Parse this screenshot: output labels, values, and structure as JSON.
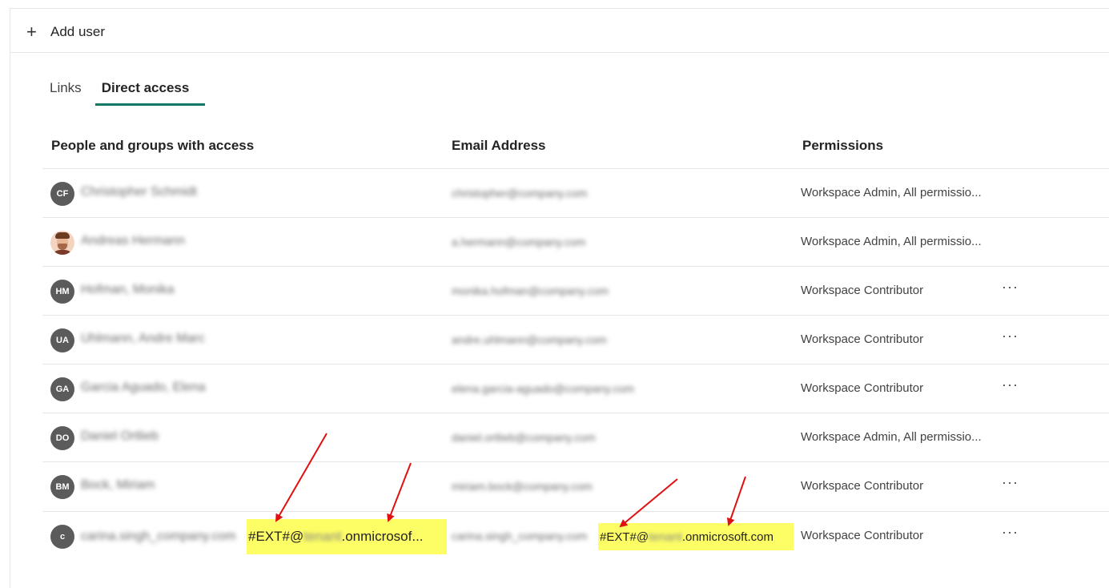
{
  "toolbar": {
    "add_user_label": "Add user"
  },
  "tabs": [
    {
      "label": "Links",
      "active": false
    },
    {
      "label": "Direct access",
      "active": true
    }
  ],
  "columns": {
    "name": "People and groups with access",
    "email": "Email Address",
    "permissions": "Permissions"
  },
  "rows": [
    {
      "initials": "CF",
      "name": "Christopher Schmidt",
      "email": "christopher@company.com",
      "permission": "Workspace Admin, All permissio..."
    },
    {
      "initials": "",
      "name": "Andreas Hermann",
      "email": "a.hermann@company.com",
      "permission": "Workspace Admin, All permissio..."
    },
    {
      "initials": "HM",
      "name": "Hofman, Monika",
      "email": "monika.hofman@company.com",
      "permission": "Workspace Contributor"
    },
    {
      "initials": "UA",
      "name": "Uhlmann, Andre Marc",
      "email": "andre.uhlmann@company.com",
      "permission": "Workspace Contributor"
    },
    {
      "initials": "GA",
      "name": "Garcia Aguado, Elena",
      "email": "elena.garcia-aguado@company.com",
      "permission": "Workspace Contributor"
    },
    {
      "initials": "DO",
      "name": "Daniel Ortlieb",
      "email": "daniel.ortlieb@company.com",
      "permission": "Workspace Admin, All permissio..."
    },
    {
      "initials": "BM",
      "name": "Bock, Miriam",
      "email": "miriam.bock@company.com",
      "permission": "Workspace Contributor"
    },
    {
      "initials": "c",
      "name": "carina.singh_company.com",
      "email": "carina.singh_company.com",
      "permission": "Workspace Contributor",
      "name_ext_prefix": "#EXT#@",
      "name_ext_suffix": ".onmicrosof...",
      "email_ext_prefix": "#EXT#@",
      "email_ext_suffix": ".onmicrosoft.com",
      "tenant": "tenant"
    }
  ],
  "more_actions_glyph": "···",
  "colors": {
    "accent": "#117865",
    "avatar": "#5b5b5b",
    "highlight": "#fdfd66",
    "annotation": "#e01010"
  }
}
